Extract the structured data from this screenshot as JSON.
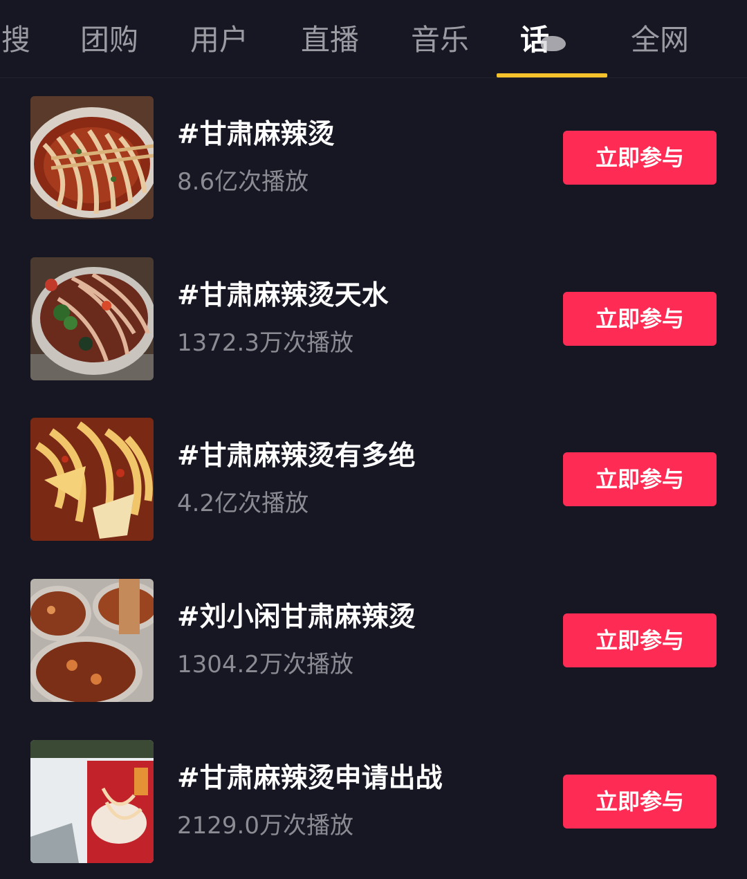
{
  "tabs": [
    {
      "label": "搜"
    },
    {
      "label": "团购"
    },
    {
      "label": "用户"
    },
    {
      "label": "直播"
    },
    {
      "label": "音乐"
    },
    {
      "label": "话"
    },
    {
      "label": "全网"
    }
  ],
  "active_tab": "话",
  "colors": {
    "background": "#161722",
    "accent_underline": "#f6c22b",
    "button": "#fe2c55",
    "muted_text": "#8a8b93"
  },
  "topics": [
    {
      "title": "#甘肃麻辣烫",
      "plays": "8.6亿次播放",
      "button": "立即参与",
      "thumb_icon": "spicy-noodle-bowl-image"
    },
    {
      "title": "#甘肃麻辣烫天水",
      "plays": "1372.3万次播放",
      "button": "立即参与",
      "thumb_icon": "noodle-bowl-vegetables-image"
    },
    {
      "title": "#甘肃麻辣烫有多绝",
      "plays": "4.2亿次播放",
      "button": "立即参与",
      "thumb_icon": "wide-noodles-image"
    },
    {
      "title": "#刘小闲甘肃麻辣烫",
      "plays": "1304.2万次播放",
      "button": "立即参与",
      "thumb_icon": "takeout-bowls-image"
    },
    {
      "title": "#甘肃麻辣烫申请出战",
      "plays": "2129.0万次播放",
      "button": "立即参与",
      "thumb_icon": "restaurant-wall-poster-image"
    }
  ]
}
